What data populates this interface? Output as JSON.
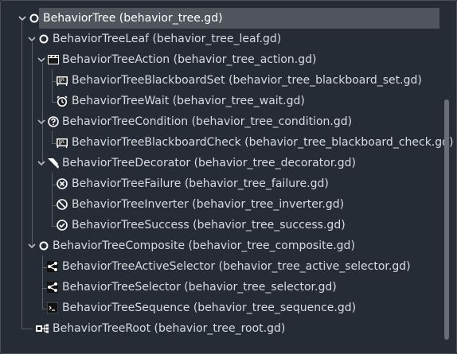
{
  "tree": {
    "root": {
      "label": "BehaviorTree (behavior_tree.gd)",
      "icon": "circle-icon"
    },
    "leaf": {
      "label": "BehaviorTreeLeaf (behavior_tree_leaf.gd)",
      "icon": "circle-icon"
    },
    "action": {
      "label": "BehaviorTreeAction (behavior_tree_action.gd)",
      "icon": "clapperboard-icon"
    },
    "blackboard_set": {
      "label": "BehaviorTreeBlackboardSet (behavior_tree_blackboard_set.gd)",
      "icon": "blackboard-icon"
    },
    "wait": {
      "label": "BehaviorTreeWait (behavior_tree_wait.gd)",
      "icon": "alarm-clock-icon"
    },
    "condition": {
      "label": "BehaviorTreeCondition (behavior_tree_condition.gd)",
      "icon": "question-icon"
    },
    "blackboard_check": {
      "label": "BehaviorTreeBlackboardCheck (behavior_tree_blackboard_check.gd)",
      "icon": "blackboard-icon"
    },
    "decorator": {
      "label": "BehaviorTreeDecorator (behavior_tree_decorator.gd)",
      "icon": "paint-brush-icon"
    },
    "failure": {
      "label": "BehaviorTreeFailure (behavior_tree_failure.gd)",
      "icon": "x-circle-icon"
    },
    "inverter": {
      "label": "BehaviorTreeInverter (behavior_tree_inverter.gd)",
      "icon": "no-sign-icon"
    },
    "success": {
      "label": "BehaviorTreeSuccess (behavior_tree_success.gd)",
      "icon": "check-circle-icon"
    },
    "composite": {
      "label": "BehaviorTreeComposite (behavior_tree_composite.gd)",
      "icon": "circle-icon"
    },
    "active_selector": {
      "label": "BehaviorTreeActiveSelector (behavior_tree_active_selector.gd)",
      "icon": "branch-icon"
    },
    "selector": {
      "label": "BehaviorTreeSelector (behavior_tree_selector.gd)",
      "icon": "branch-icon"
    },
    "sequence": {
      "label": "BehaviorTreeSequence (behavior_tree_sequence.gd)",
      "icon": "terminal-icon"
    },
    "tree_root": {
      "label": "BehaviorTreeRoot (behavior_tree_root.gd)",
      "icon": "root-graph-icon"
    }
  },
  "colors": {
    "background": "#262c36",
    "selected_row": "#50555d",
    "text": "#d8dbe0",
    "guide": "#5b6068"
  }
}
